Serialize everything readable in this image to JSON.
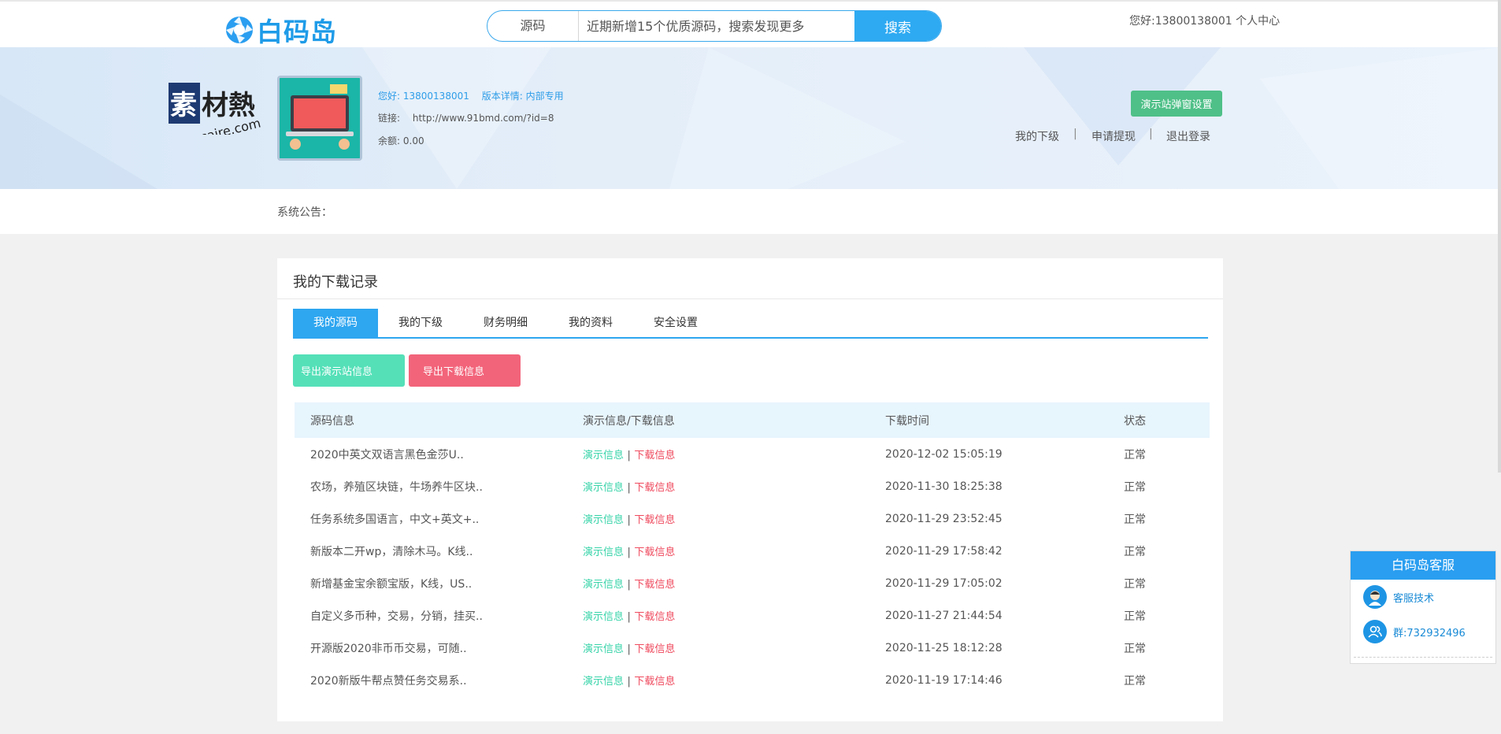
{
  "header": {
    "logo_text": "白码岛",
    "search": {
      "category": "源码",
      "placeholder": "近期新增15个优质源码，搜索发现更多",
      "button": "搜索"
    },
    "user_greeting": "您好:13800138001",
    "user_center": "个人中心"
  },
  "profile": {
    "hello_label": "您好:",
    "phone": "13800138001",
    "version_label": "版本详情:",
    "version_value": "内部专用",
    "link_label": "链接:",
    "link_value": "http://www.91bmd.com/?id=8",
    "balance_label": "余额:",
    "balance_value": "0.00",
    "demo_settings_button": "演示站弹窗设置",
    "sub_nav": [
      "我的下级",
      "申请提现",
      "退出登录"
    ],
    "separator": "|"
  },
  "watermark": {
    "big": "素材熱",
    "small": "sucaire.com"
  },
  "notice": {
    "label": "系统公告："
  },
  "panel": {
    "title": "我的下载记录",
    "tabs": [
      "我的源码",
      "我的下级",
      "财务明细",
      "我的资料",
      "安全设置"
    ],
    "active_tab": 0,
    "export_demo_button": "导出演示站信息",
    "export_download_button": "导出下载信息",
    "columns": [
      "源码信息",
      "演示信息/下载信息",
      "下载时间",
      "状态"
    ],
    "demo_link": "演示信息",
    "download_link": "下载信息",
    "link_sep": "|",
    "rows": [
      {
        "name": "2020中英文双语言黑色金莎U..",
        "time": "2020-12-02 15:05:19",
        "status": "正常"
      },
      {
        "name": "农场，养殖区块链，牛场养牛区块..",
        "time": "2020-11-30 18:25:38",
        "status": "正常"
      },
      {
        "name": "任务系统多国语言，中文+英文+..",
        "time": "2020-11-29 23:52:45",
        "status": "正常"
      },
      {
        "name": "新版本二开wp，清除木马。K线..",
        "time": "2020-11-29 17:58:42",
        "status": "正常"
      },
      {
        "name": "新增基金宝余额宝版，K线，US..",
        "time": "2020-11-29 17:05:02",
        "status": "正常"
      },
      {
        "name": "自定义多币种，交易，分销，挂买..",
        "time": "2020-11-27 21:44:54",
        "status": "正常"
      },
      {
        "name": "开源版2020非币币交易，可随..",
        "time": "2020-11-25 18:12:28",
        "status": "正常"
      },
      {
        "name": "2020新版牛帮点赞任务交易系..",
        "time": "2020-11-19 17:14:46",
        "status": "正常"
      }
    ]
  },
  "service": {
    "title": "白码岛客服",
    "tech": "客服技术",
    "group": "群:732932496"
  }
}
